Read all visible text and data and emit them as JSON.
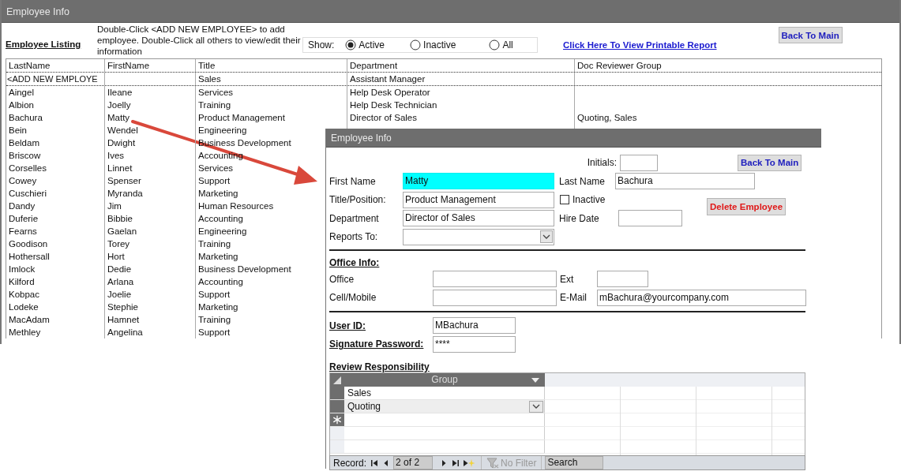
{
  "window": {
    "title": "Employee Info"
  },
  "listing": {
    "heading": "Employee Listing",
    "instructions": "Double-Click <ADD NEW EMPLOYEE> to add employee. Double-Click all others to view/edit their information",
    "show": {
      "label": "Show:",
      "options": [
        {
          "label": "Active",
          "selected": true
        },
        {
          "label": "Inactive",
          "selected": false
        },
        {
          "label": "All",
          "selected": false
        }
      ]
    },
    "report_link": "Click Here To View Printable Report",
    "back_button": "Back To Main",
    "table": {
      "columns": [
        "LastName",
        "FirstName",
        "Title",
        "Department",
        "Doc Reviewer Group"
      ],
      "rows": [
        {
          "kind": "new",
          "last_name": "<ADD NEW EMPLOYE",
          "title": "Sales",
          "department": "Assistant Manager"
        },
        {
          "kind": "record",
          "last_name": "Aingel",
          "first_name": "Ileane",
          "title": "Services",
          "department": "Help Desk Operator"
        },
        {
          "kind": "record",
          "last_name": "Albion",
          "first_name": "Joelly",
          "title": "Training",
          "department": "Help Desk Technician"
        },
        {
          "kind": "record",
          "last_name": "Bachura",
          "first_name": "Matty",
          "title": "Product Management",
          "department": "Director of Sales",
          "doc_reviewer_group": "Quoting, Sales"
        },
        {
          "last_name": "Bein",
          "first_name": "Wendel",
          "title": "Engineering",
          "kind": "record"
        },
        {
          "kind": "record",
          "last_name": "Beldam",
          "first_name": "Dwight",
          "title": "Business Development"
        },
        {
          "kind": "record",
          "last_name": "Briscow",
          "first_name": "Ives",
          "title": "Accounting"
        },
        {
          "kind": "record",
          "last_name": "Corselles",
          "first_name": "Linnet",
          "title": "Services"
        },
        {
          "kind": "record",
          "last_name": "Cowey",
          "first_name": "Spenser",
          "title": "Support"
        },
        {
          "kind": "record",
          "last_name": "Cuschieri",
          "first_name": "Myranda",
          "title": "Marketing"
        },
        {
          "kind": "record",
          "last_name": "Dandy",
          "first_name": "Jim",
          "title": "Human Resources"
        },
        {
          "kind": "record",
          "last_name": "Duferie",
          "first_name": "Bibbie",
          "title": "Accounting"
        },
        {
          "kind": "record",
          "last_name": "Fearns",
          "first_name": "Gaelan",
          "title": "Engineering"
        },
        {
          "kind": "record",
          "last_name": "Goodison",
          "first_name": "Torey",
          "title": "Training"
        },
        {
          "kind": "record",
          "last_name": "Hothersall",
          "first_name": "Hort",
          "title": "Marketing"
        },
        {
          "kind": "record",
          "last_name": "Imlock",
          "first_name": "Dedie",
          "title": "Business Development"
        },
        {
          "kind": "record",
          "last_name": "Kilford",
          "first_name": "Arlana",
          "title": "Accounting"
        },
        {
          "kind": "record",
          "last_name": "Kobpac",
          "first_name": "Joelie",
          "title": "Support"
        },
        {
          "kind": "record",
          "last_name": "Lodeke",
          "first_name": "Stephie",
          "title": "Marketing"
        },
        {
          "kind": "record",
          "last_name": "MacAdam",
          "first_name": "Hamnet",
          "title": "Training"
        },
        {
          "kind": "record",
          "last_name": "Methley",
          "first_name": "Angelina",
          "title": "Support"
        }
      ]
    }
  },
  "dialog": {
    "title": "Employee Info",
    "initials": {
      "label": "Initials:"
    },
    "back_button": "Back To Main",
    "first_name": {
      "label": "First Name",
      "value": "Matty",
      "focused": true
    },
    "last_name": {
      "label": "Last Name",
      "value": "Bachura",
      "focused": false
    },
    "title_position": {
      "label": "Title/Position:",
      "value": "Product Management",
      "focused": false
    },
    "inactive": {
      "label": "Inactive",
      "checked": false
    },
    "delete_button": "Delete Employee",
    "department": {
      "label": "Department",
      "value": "Director of Sales",
      "focused": false
    },
    "hire_date": {
      "label": "Hire Date"
    },
    "reports_to": {
      "label": "Reports To:"
    },
    "office_info": {
      "heading": "Office Info:",
      "office": {
        "label": "Office"
      },
      "ext": {
        "label": "Ext"
      },
      "cell_mobile": {
        "label": "Cell/Mobile"
      },
      "email": {
        "label": "E-Mail",
        "value": "mBachura@yourcompany.com"
      }
    },
    "user_id": {
      "label": "User ID:",
      "value": "MBachura"
    },
    "signature_password": {
      "label": "Signature Password:",
      "value": "****"
    },
    "review_responsibility": {
      "heading": "Review Responsibility",
      "column": "Group",
      "rows": [
        {
          "value": "Sales",
          "selected": false
        },
        {
          "value": "Quoting",
          "selected": true
        }
      ],
      "navigation": {
        "record_label": "Record:",
        "position": "2 of 2",
        "filter": "No Filter",
        "search": "Search"
      }
    }
  }
}
